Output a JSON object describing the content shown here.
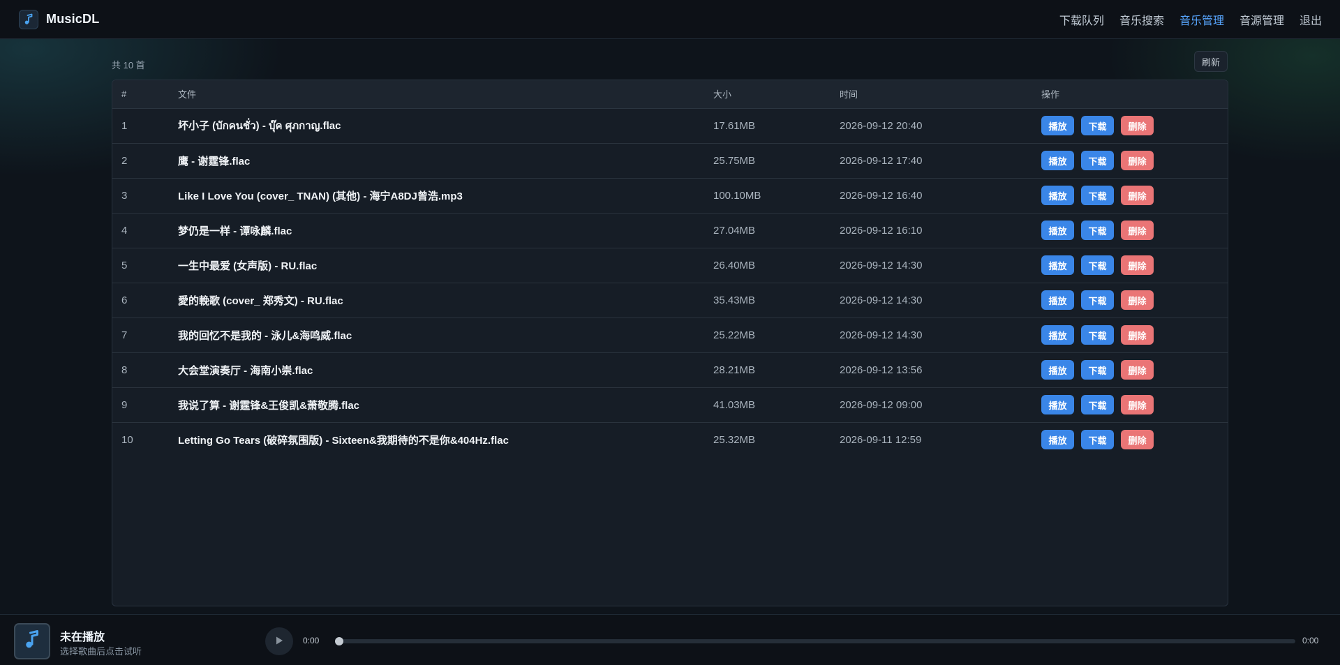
{
  "app": {
    "name": "MusicDL"
  },
  "nav": [
    {
      "label": "下载队列",
      "active": false
    },
    {
      "label": "音乐搜索",
      "active": false
    },
    {
      "label": "音乐管理",
      "active": true
    },
    {
      "label": "音源管理",
      "active": false
    },
    {
      "label": "退出",
      "active": false
    }
  ],
  "toolbar": {
    "count_label": "共 10 首",
    "refresh_label": "刷新"
  },
  "table": {
    "headers": {
      "index": "#",
      "file": "文件",
      "size": "大小",
      "time": "时间",
      "actions": "操作"
    },
    "action_labels": {
      "play": "播放",
      "download": "下载",
      "delete": "删除"
    },
    "rows": [
      {
        "index": "1",
        "file": "坏小子 (บักคนชั่ว) - บุ๊ค ศุภกาญ.flac",
        "size": "17.61MB",
        "time": "2026-09-12 20:40"
      },
      {
        "index": "2",
        "file": "鹰 - 谢霆锋.flac",
        "size": "25.75MB",
        "time": "2026-09-12 17:40"
      },
      {
        "index": "3",
        "file": "Like I Love You (cover_ TNAN) (其他) - 海宁A8DJ曾浩.mp3",
        "size": "100.10MB",
        "time": "2026-09-12 16:40"
      },
      {
        "index": "4",
        "file": "梦仍是一样 - 谭咏麟.flac",
        "size": "27.04MB",
        "time": "2026-09-12 16:10"
      },
      {
        "index": "5",
        "file": "一生中最爱 (女声版) - RU.flac",
        "size": "26.40MB",
        "time": "2026-09-12 14:30"
      },
      {
        "index": "6",
        "file": "愛的輓歌 (cover_ 郑秀文) - RU.flac",
        "size": "35.43MB",
        "time": "2026-09-12 14:30"
      },
      {
        "index": "7",
        "file": "我的回忆不是我的 - 泳儿&海鸣威.flac",
        "size": "25.22MB",
        "time": "2026-09-12 14:30"
      },
      {
        "index": "8",
        "file": "大会堂演奏厅 - 海南小崇.flac",
        "size": "28.21MB",
        "time": "2026-09-12 13:56"
      },
      {
        "index": "9",
        "file": "我说了算 - 谢霆锋&王俊凯&萧敬腾.flac",
        "size": "41.03MB",
        "time": "2026-09-12 09:00"
      },
      {
        "index": "10",
        "file": "Letting Go Tears (破碎氛围版) - Sixteen&我期待的不是你&404Hz.flac",
        "size": "25.32MB",
        "time": "2026-09-11 12:59"
      }
    ]
  },
  "player": {
    "title": "未在播放",
    "subtitle": "选择歌曲后点击试听",
    "current_time": "0:00",
    "total_time": "0:00",
    "progress": 0
  },
  "colors": {
    "accent": "#3a86e8",
    "active_nav": "#58a6ff",
    "danger": "#ea7576",
    "background": "#0e141b"
  },
  "icons": {
    "logo": "music-note-icon",
    "cover": "music-note-icon",
    "play": "play-icon"
  }
}
